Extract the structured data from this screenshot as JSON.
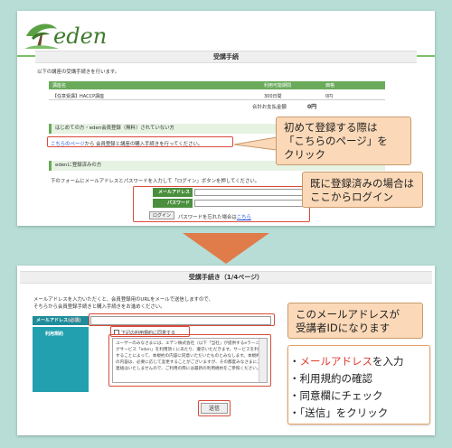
{
  "logo": {
    "text": "eden"
  },
  "step1": {
    "title": "受講手続",
    "intro": "以下の講座の受講手続きを行います。",
    "table": {
      "headers": [
        "講座名",
        "利用可能期間",
        "価格"
      ],
      "row": [
        "【任意受講】HACCP講座",
        "300日間",
        "0円"
      ],
      "total_label": "合計お支払金額",
      "total_value": "0円"
    },
    "new_user": {
      "heading": "はじめての方・eden会員登録（無料）されていない方",
      "link": "こちらのページ",
      "text": "から 会員登録と講座の購入手続きを行ってください。"
    },
    "registered": {
      "heading": "edenに登録済みの方",
      "instruction": "下のフォームにメールアドレスとパスワードを入力して「ログイン」ボタンを押してください。",
      "email_label": "メールアドレス",
      "password_label": "パスワード",
      "login_button": "ログイン",
      "forgot_text": "パスワードを忘れた場合は",
      "forgot_link": "こちら"
    }
  },
  "callouts": {
    "first_time": [
      "初めて登録する際は",
      "「こちらのページ」を",
      "クリック"
    ],
    "registered": [
      "既に登録済みの場合は",
      "ここからログイン"
    ],
    "email_id": [
      "このメールアドレスが",
      "受講者IDになります"
    ]
  },
  "step2": {
    "title": "受講手続き（1/4ページ）",
    "intro1": "メールアドレスを入力いただくと、会員登録用のURLをメールで送信しますので、",
    "intro2": "そちらから会員登録手続きと購入手続きをお進めください。",
    "email_label": "メールアドレス",
    "email_required": "(必須)",
    "terms_label": "利用規約",
    "agree_label": "下記の利用規約に同意する",
    "terms_text": "ユーザーのみなさまには、エデン株式会社（以下「当社」が提供するeラーニングサービス「eden」を利用頂くにあたり、遵守いただきます。サービスを利用することによって、本規約の内容に同意いただいたものとみなします。本規約の内容は、必要に応じて変更することがございますが、その都度みなさまにご連絡はいたしませんので、ご利用の際には最新の利用規約をご参照ください。",
    "send_button": "送信"
  },
  "tips": {
    "bullet": "・",
    "email_highlight": "メールアドレス",
    "email_suffix": "を入力",
    "item2": "利用規約の確認",
    "item3": "同意欄にチェック",
    "item4": "「送信」をクリック"
  },
  "colors": {
    "background": "#b7ddd6",
    "eden_green": "#6aab5b",
    "teal": "#22a0b0",
    "highlight_red": "#d94b3b",
    "callout_orange": "#fbd9b8",
    "arrow_orange": "#e07b4a"
  }
}
